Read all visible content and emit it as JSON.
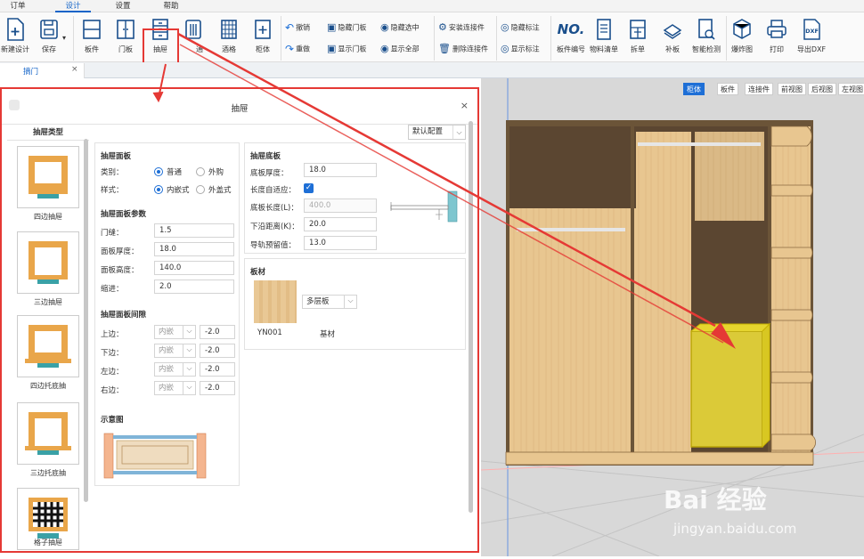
{
  "menu": {
    "tabs": [
      {
        "label": "订单"
      },
      {
        "label": "设计"
      },
      {
        "label": "设置"
      },
      {
        "label": "帮助"
      }
    ]
  },
  "toolbar": {
    "new_design": "新建设计",
    "save": "保存",
    "board": "板件",
    "door": "门板",
    "drawer": "抽屉",
    "partial_label": "通",
    "wine_rack": "酒格",
    "cabinet": "柜体",
    "undo": "撤销",
    "redo": "重做",
    "hide_door": "隐藏门板",
    "show_door": "显示门板",
    "hide_selected": "隐藏选中",
    "show_all": "显示全部",
    "install_connector": "安装连接件",
    "delete_connector": "删除连接件",
    "hide_annotation": "隐藏标注",
    "show_annotation": "显示标注",
    "numbering_icon": "NO.",
    "board_numbering": "板件编号",
    "material_list": "物料清单",
    "split_board": "拆单",
    "patch_board": "补板",
    "smart_check": "智能检测",
    "explode": "爆炸图",
    "print": "打印",
    "export_dxf": "导出DXF",
    "dxf_icon_text": "DXF"
  },
  "doc_tab": {
    "label": "摘门",
    "close": "×"
  },
  "view_buttons": [
    {
      "label": "柜体"
    },
    {
      "label": "板件"
    },
    {
      "label": "连接件"
    },
    {
      "label": "前视图"
    },
    {
      "label": "后视图"
    },
    {
      "label": "左视图"
    }
  ],
  "dialog": {
    "title": "抽屉",
    "close": "×",
    "preset": "默认配置",
    "drawer_types_title": "抽屉类型",
    "drawer_types": [
      {
        "label": "四边抽屉"
      },
      {
        "label": "三边抽屉"
      },
      {
        "label": "四边托底抽"
      },
      {
        "label": "三边托底抽"
      },
      {
        "label": "格子抽屉"
      }
    ],
    "face": {
      "title": "抽屉面板",
      "category_label": "类别：",
      "category_options": [
        "普通",
        "外购"
      ],
      "style_label": "样式：",
      "style_options": [
        "内嵌式",
        "外盖式"
      ]
    },
    "face_params": {
      "title": "抽屉面板参数",
      "fields": [
        {
          "label": "门缝：",
          "value": "1.5"
        },
        {
          "label": "面板厚度：",
          "value": "18.0"
        },
        {
          "label": "面板高度：",
          "value": "140.0"
        },
        {
          "label": "缩进：",
          "value": "2.0"
        }
      ]
    },
    "gaps": {
      "title": "抽屉面板间隙",
      "rows": [
        {
          "label": "上边：",
          "mode": "内嵌",
          "value": "-2.0"
        },
        {
          "label": "下边：",
          "mode": "内嵌",
          "value": "-2.0"
        },
        {
          "label": "左边：",
          "mode": "内嵌",
          "value": "-2.0"
        },
        {
          "label": "右边：",
          "mode": "内嵌",
          "value": "-2.0"
        }
      ]
    },
    "diagram_title": "示意图",
    "bottom": {
      "title": "抽屉底板",
      "fields": [
        {
          "label": "底板厚度：",
          "value": "18.0"
        },
        {
          "label": "长度自适应：",
          "value": ""
        },
        {
          "label": "底板长度(L)：",
          "value": "400.0"
        },
        {
          "label": "下沿距离(K)：",
          "value": "20.0"
        },
        {
          "label": "导轨预留值：",
          "value": "13.0"
        }
      ]
    },
    "material": {
      "title": "板材",
      "code": "YN001",
      "type": "多层板",
      "base": "基材"
    }
  },
  "watermark": {
    "line1": "Bai 经验",
    "line2": "jingyan.baidu.com"
  },
  "colors": {
    "accent": "#1e6fd6",
    "highlight": "#e53935",
    "wood": "#e8c690",
    "drawer_selected": "#f2e23a"
  }
}
